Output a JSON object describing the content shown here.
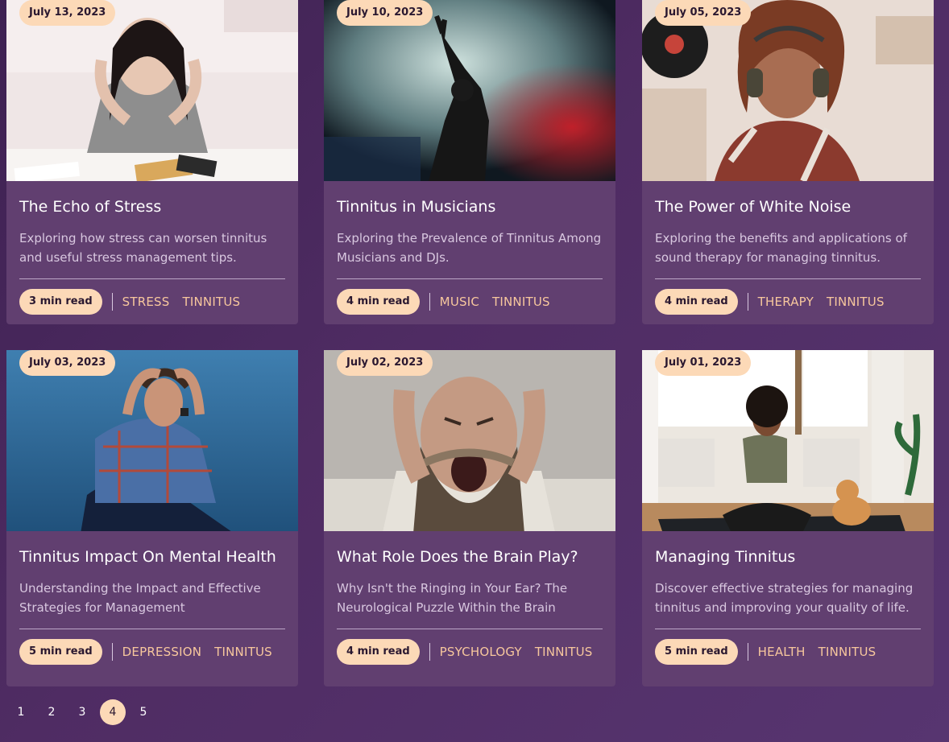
{
  "cards": [
    {
      "date": "July 13, 2023",
      "title": "The Echo of Stress",
      "description": "Exploring how stress can worsen tinnitus and useful stress management tips.",
      "read_time": "3 min read",
      "tags": [
        "STRESS",
        "TINNITUS"
      ],
      "image_name": "woman-stressed-photo"
    },
    {
      "date": "July 10, 2023",
      "title": "Tinnitus in Musicians",
      "description": "Exploring the Prevalence of Tinnitus Among Musicians and DJs.",
      "read_time": "4 min read",
      "tags": [
        "MUSIC",
        "TINNITUS"
      ],
      "image_name": "concert-performer-photo"
    },
    {
      "date": "July 05, 2023",
      "title": "The Power of White Noise",
      "description": "Exploring the benefits and applications of sound therapy for managing tinnitus.",
      "read_time": "4 min read",
      "tags": [
        "THERAPY",
        "TINNITUS"
      ],
      "image_name": "woman-headphones-photo"
    },
    {
      "date": "July 03, 2023",
      "title": "Tinnitus Impact On Mental Health",
      "description": "Understanding the Impact and Effective Strategies for Management",
      "read_time": "5 min read",
      "tags": [
        "DEPRESSION",
        "TINNITUS"
      ],
      "image_name": "man-sitting-distressed-photo"
    },
    {
      "date": "July 02, 2023",
      "title": "What Role Does the Brain Play?",
      "description": "Why Isn't the Ringing in Your Ear? The Neurological Puzzle Within the Brain",
      "read_time": "4 min read",
      "tags": [
        "PSYCHOLOGY",
        "TINNITUS"
      ],
      "image_name": "man-covering-ears-photo"
    },
    {
      "date": "July 01, 2023",
      "title": "Managing Tinnitus",
      "description": "Discover effective strategies for managing tinnitus and improving your quality of life.",
      "read_time": "5 min read",
      "tags": [
        "HEALTH",
        "TINNITUS"
      ],
      "image_name": "woman-meditating-photo"
    }
  ],
  "pagination": {
    "pages": [
      "1",
      "2",
      "3",
      "4",
      "5"
    ],
    "current": "4"
  },
  "colors": {
    "accent": "#fcd9b7",
    "tag": "#f7c79d",
    "card": "#613f70",
    "background": "#4f2c63"
  }
}
